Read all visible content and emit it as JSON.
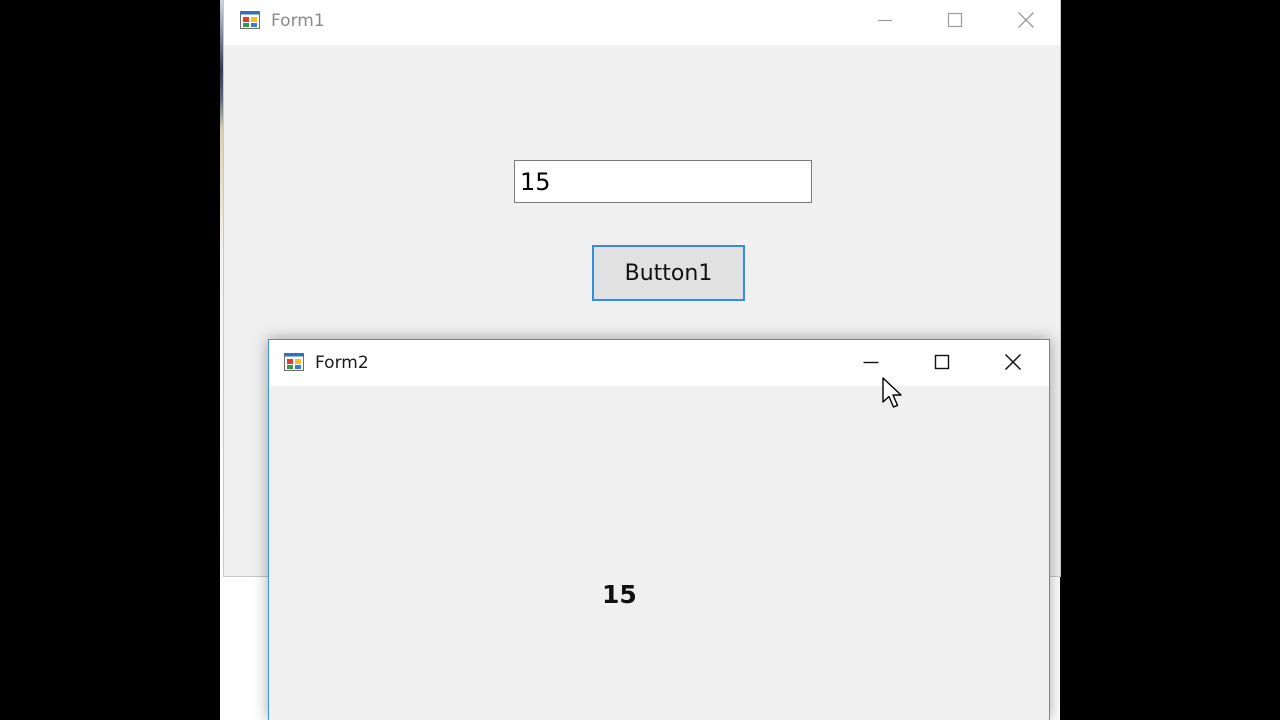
{
  "form1": {
    "title": "Form1",
    "textbox_value": "15",
    "button_label": "Button1"
  },
  "form2": {
    "title": "Form2",
    "label_text": "15"
  },
  "icons": {
    "app": "winforms-app-icon",
    "minimize": "minimize-icon",
    "maximize": "maximize-icon",
    "close": "close-icon",
    "cursor": "mouse-pointer-icon"
  },
  "colors": {
    "accent": "#3c8ad3",
    "form_background": "#f0f0f0",
    "titlebar_background": "#ffffff"
  }
}
